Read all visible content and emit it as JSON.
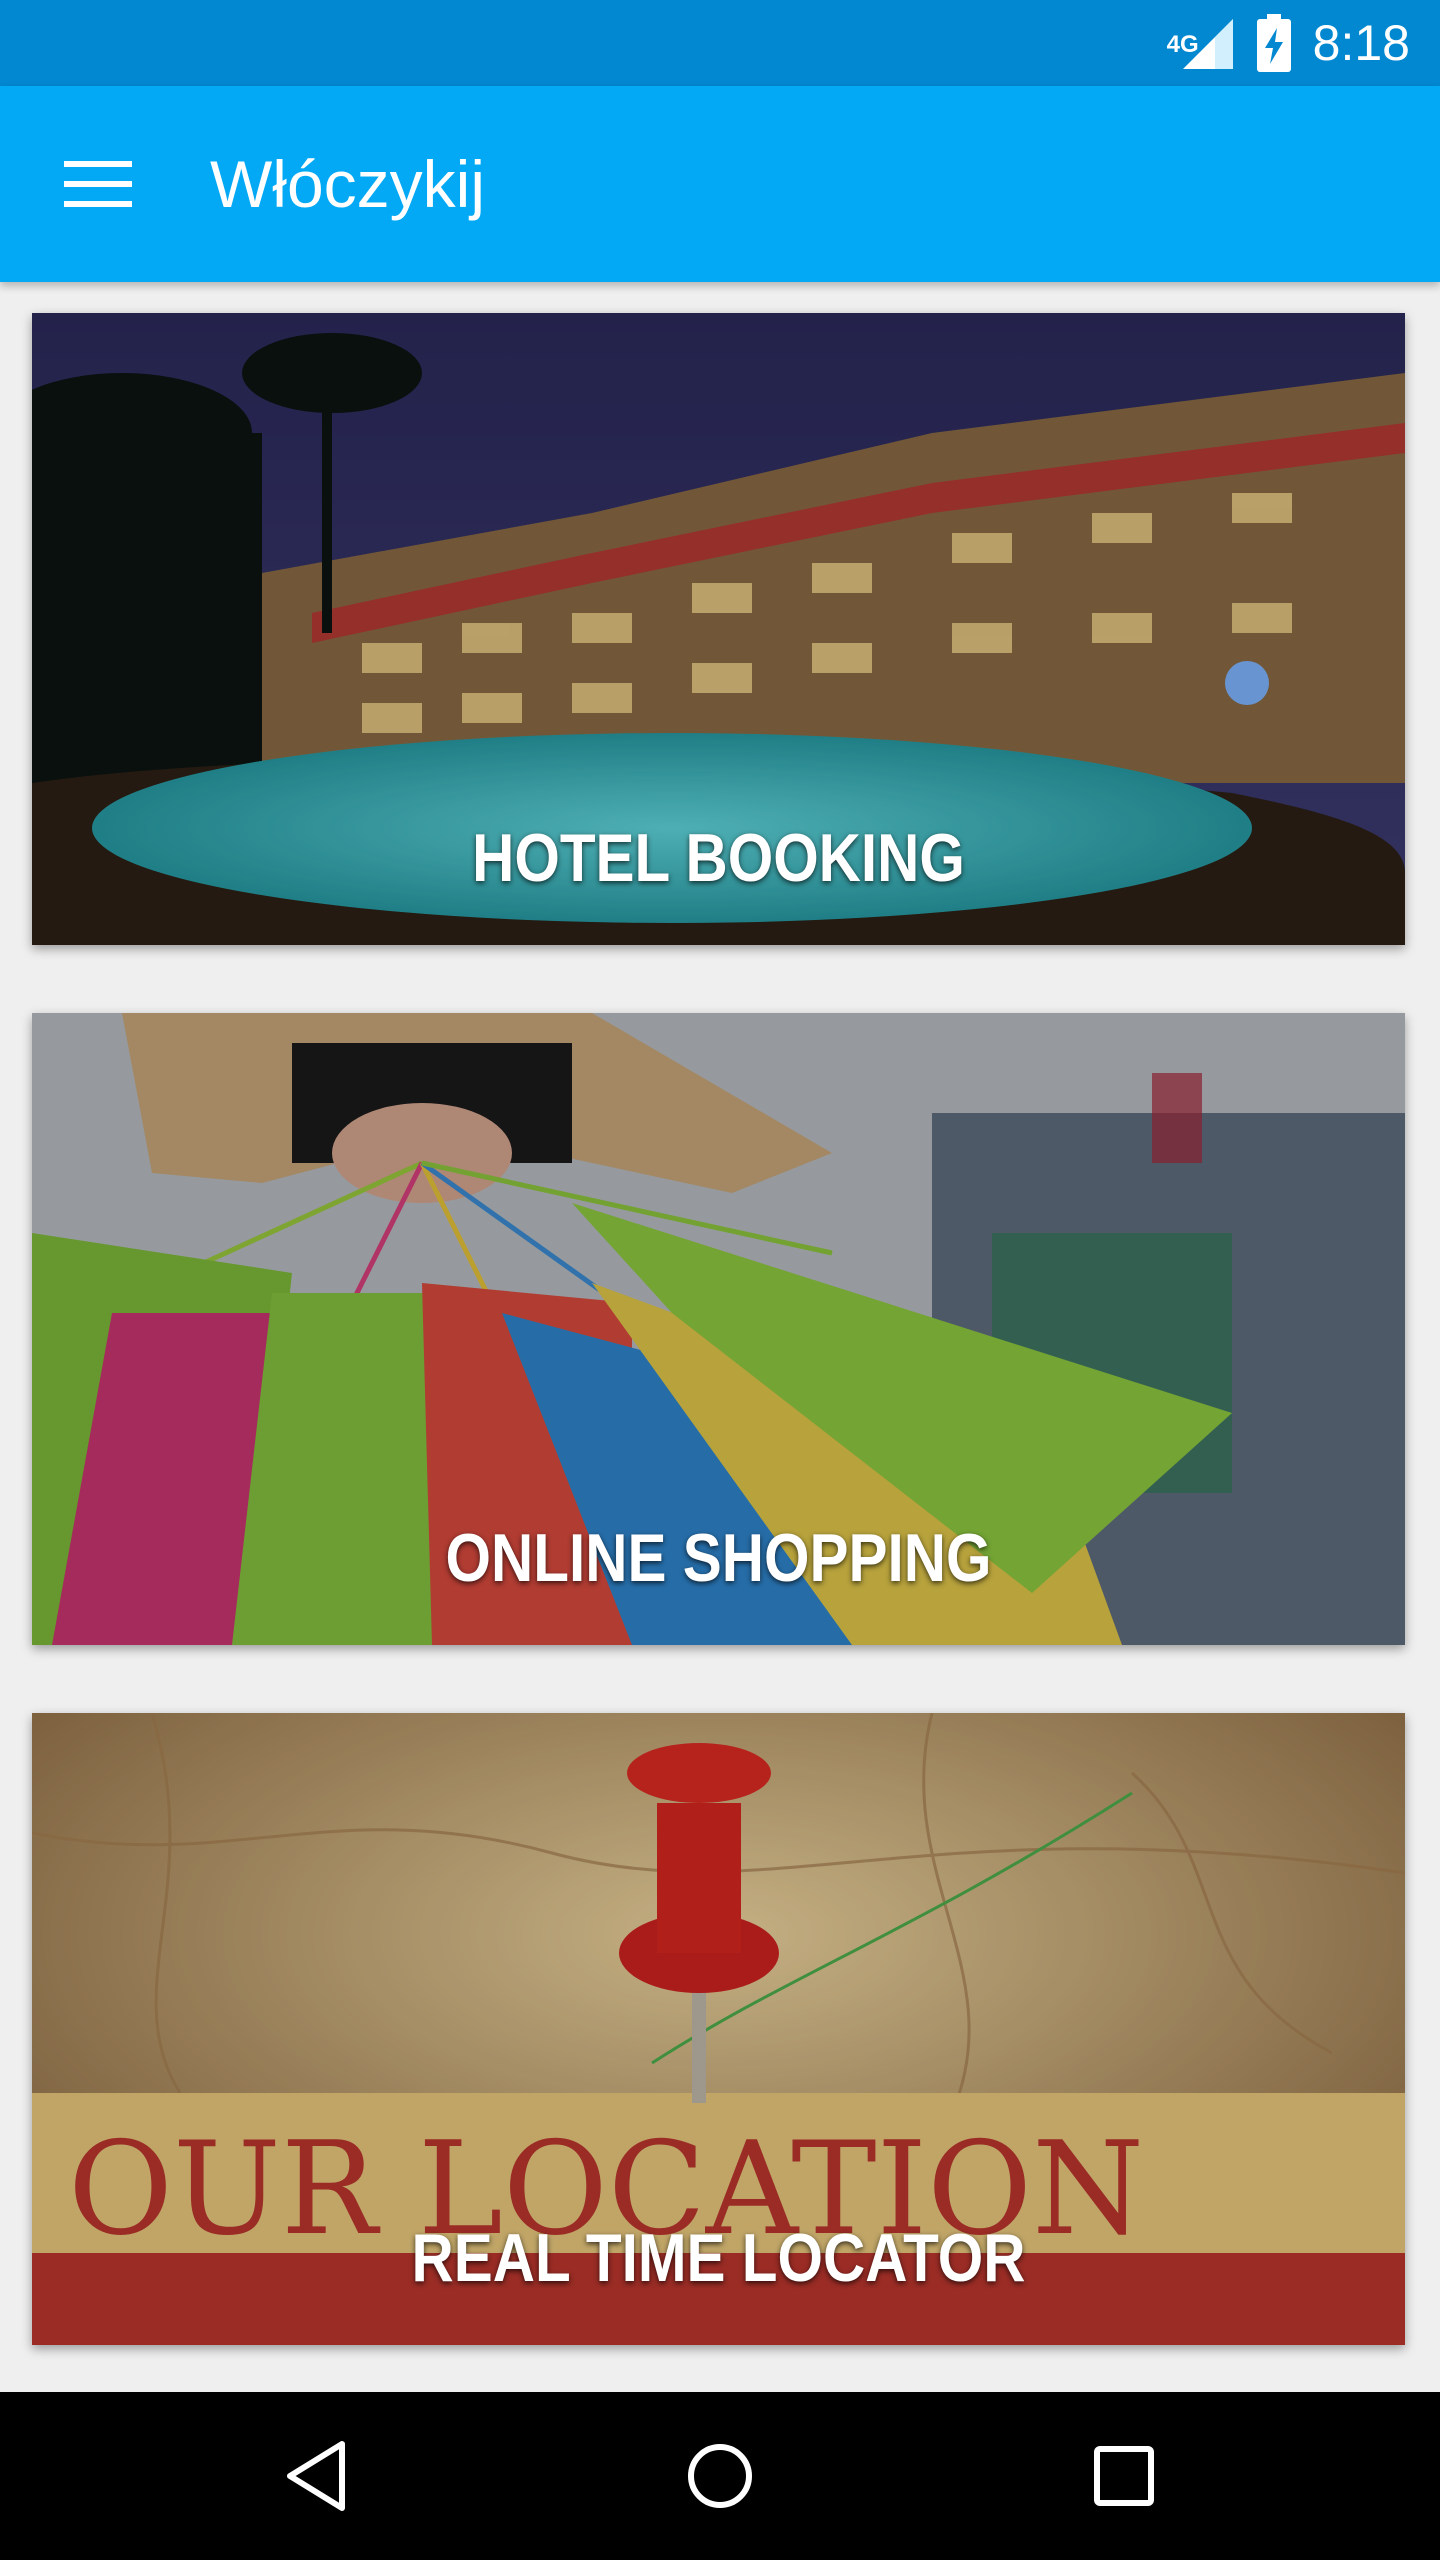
{
  "status_bar": {
    "network": "4G",
    "time": "8:18",
    "icons": [
      "cellular-signal-icon",
      "battery-charging-icon"
    ]
  },
  "app_bar": {
    "title": "Włóczykij",
    "menu_icon": "hamburger-menu-icon"
  },
  "cards": [
    {
      "label": "HOTEL BOOKING",
      "image": "hotel-pool-night-image"
    },
    {
      "label": "ONLINE SHOPPING",
      "image": "shopping-bags-image"
    },
    {
      "label": "REAL TIME LOCATOR",
      "image": "map-pushpin-image",
      "image_text": "OUR LOCATION"
    }
  ],
  "nav_bar": {
    "icons": [
      "back-icon",
      "home-icon",
      "recents-icon"
    ]
  },
  "colors": {
    "status_bar": "#0288d1",
    "app_bar": "#03a9f4",
    "background": "#efefef",
    "nav_bar": "#000000"
  }
}
